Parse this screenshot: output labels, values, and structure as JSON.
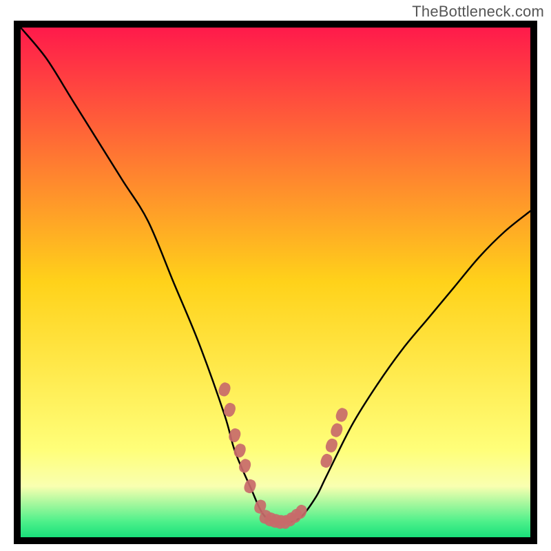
{
  "watermark": "TheBottleneck.com",
  "chart_data": {
    "type": "line",
    "title": "",
    "xlabel": "",
    "ylabel": "",
    "xlim": [
      0,
      100
    ],
    "ylim": [
      0,
      100
    ],
    "grid": false,
    "legend": false,
    "background_gradient": {
      "stops": [
        {
          "pos": 0.0,
          "color": "#ff1a4b"
        },
        {
          "pos": 0.5,
          "color": "#ffd21a"
        },
        {
          "pos": 0.83,
          "color": "#ffff7a"
        },
        {
          "pos": 0.9,
          "color": "#f9ffb0"
        },
        {
          "pos": 0.97,
          "color": "#4cf08a"
        },
        {
          "pos": 1.0,
          "color": "#19e07a"
        }
      ]
    },
    "series": [
      {
        "name": "bottleneck-curve",
        "x": [
          0,
          5,
          10,
          15,
          20,
          25,
          30,
          35,
          40,
          42,
          45,
          48,
          52,
          55,
          58,
          60,
          65,
          70,
          75,
          80,
          85,
          90,
          95,
          100
        ],
        "y": [
          100,
          94,
          86,
          78,
          70,
          62,
          50,
          38,
          24,
          17,
          10,
          4,
          3,
          4,
          8,
          12,
          22,
          30,
          37,
          43,
          49,
          55,
          60,
          64
        ]
      }
    ],
    "markers": {
      "name": "curve-markers",
      "color": "#c86a6a",
      "shape": "rounded-rect",
      "points": [
        {
          "x": 40,
          "y": 29
        },
        {
          "x": 41,
          "y": 25
        },
        {
          "x": 42,
          "y": 20
        },
        {
          "x": 43,
          "y": 17
        },
        {
          "x": 44,
          "y": 14
        },
        {
          "x": 45,
          "y": 10
        },
        {
          "x": 47,
          "y": 6
        },
        {
          "x": 48,
          "y": 4
        },
        {
          "x": 49,
          "y": 3.5
        },
        {
          "x": 50,
          "y": 3.2
        },
        {
          "x": 51,
          "y": 3
        },
        {
          "x": 52,
          "y": 3
        },
        {
          "x": 53,
          "y": 3.5
        },
        {
          "x": 54,
          "y": 4.2
        },
        {
          "x": 55,
          "y": 5
        },
        {
          "x": 60,
          "y": 15
        },
        {
          "x": 61,
          "y": 18
        },
        {
          "x": 62,
          "y": 21
        },
        {
          "x": 63,
          "y": 24
        }
      ]
    }
  }
}
